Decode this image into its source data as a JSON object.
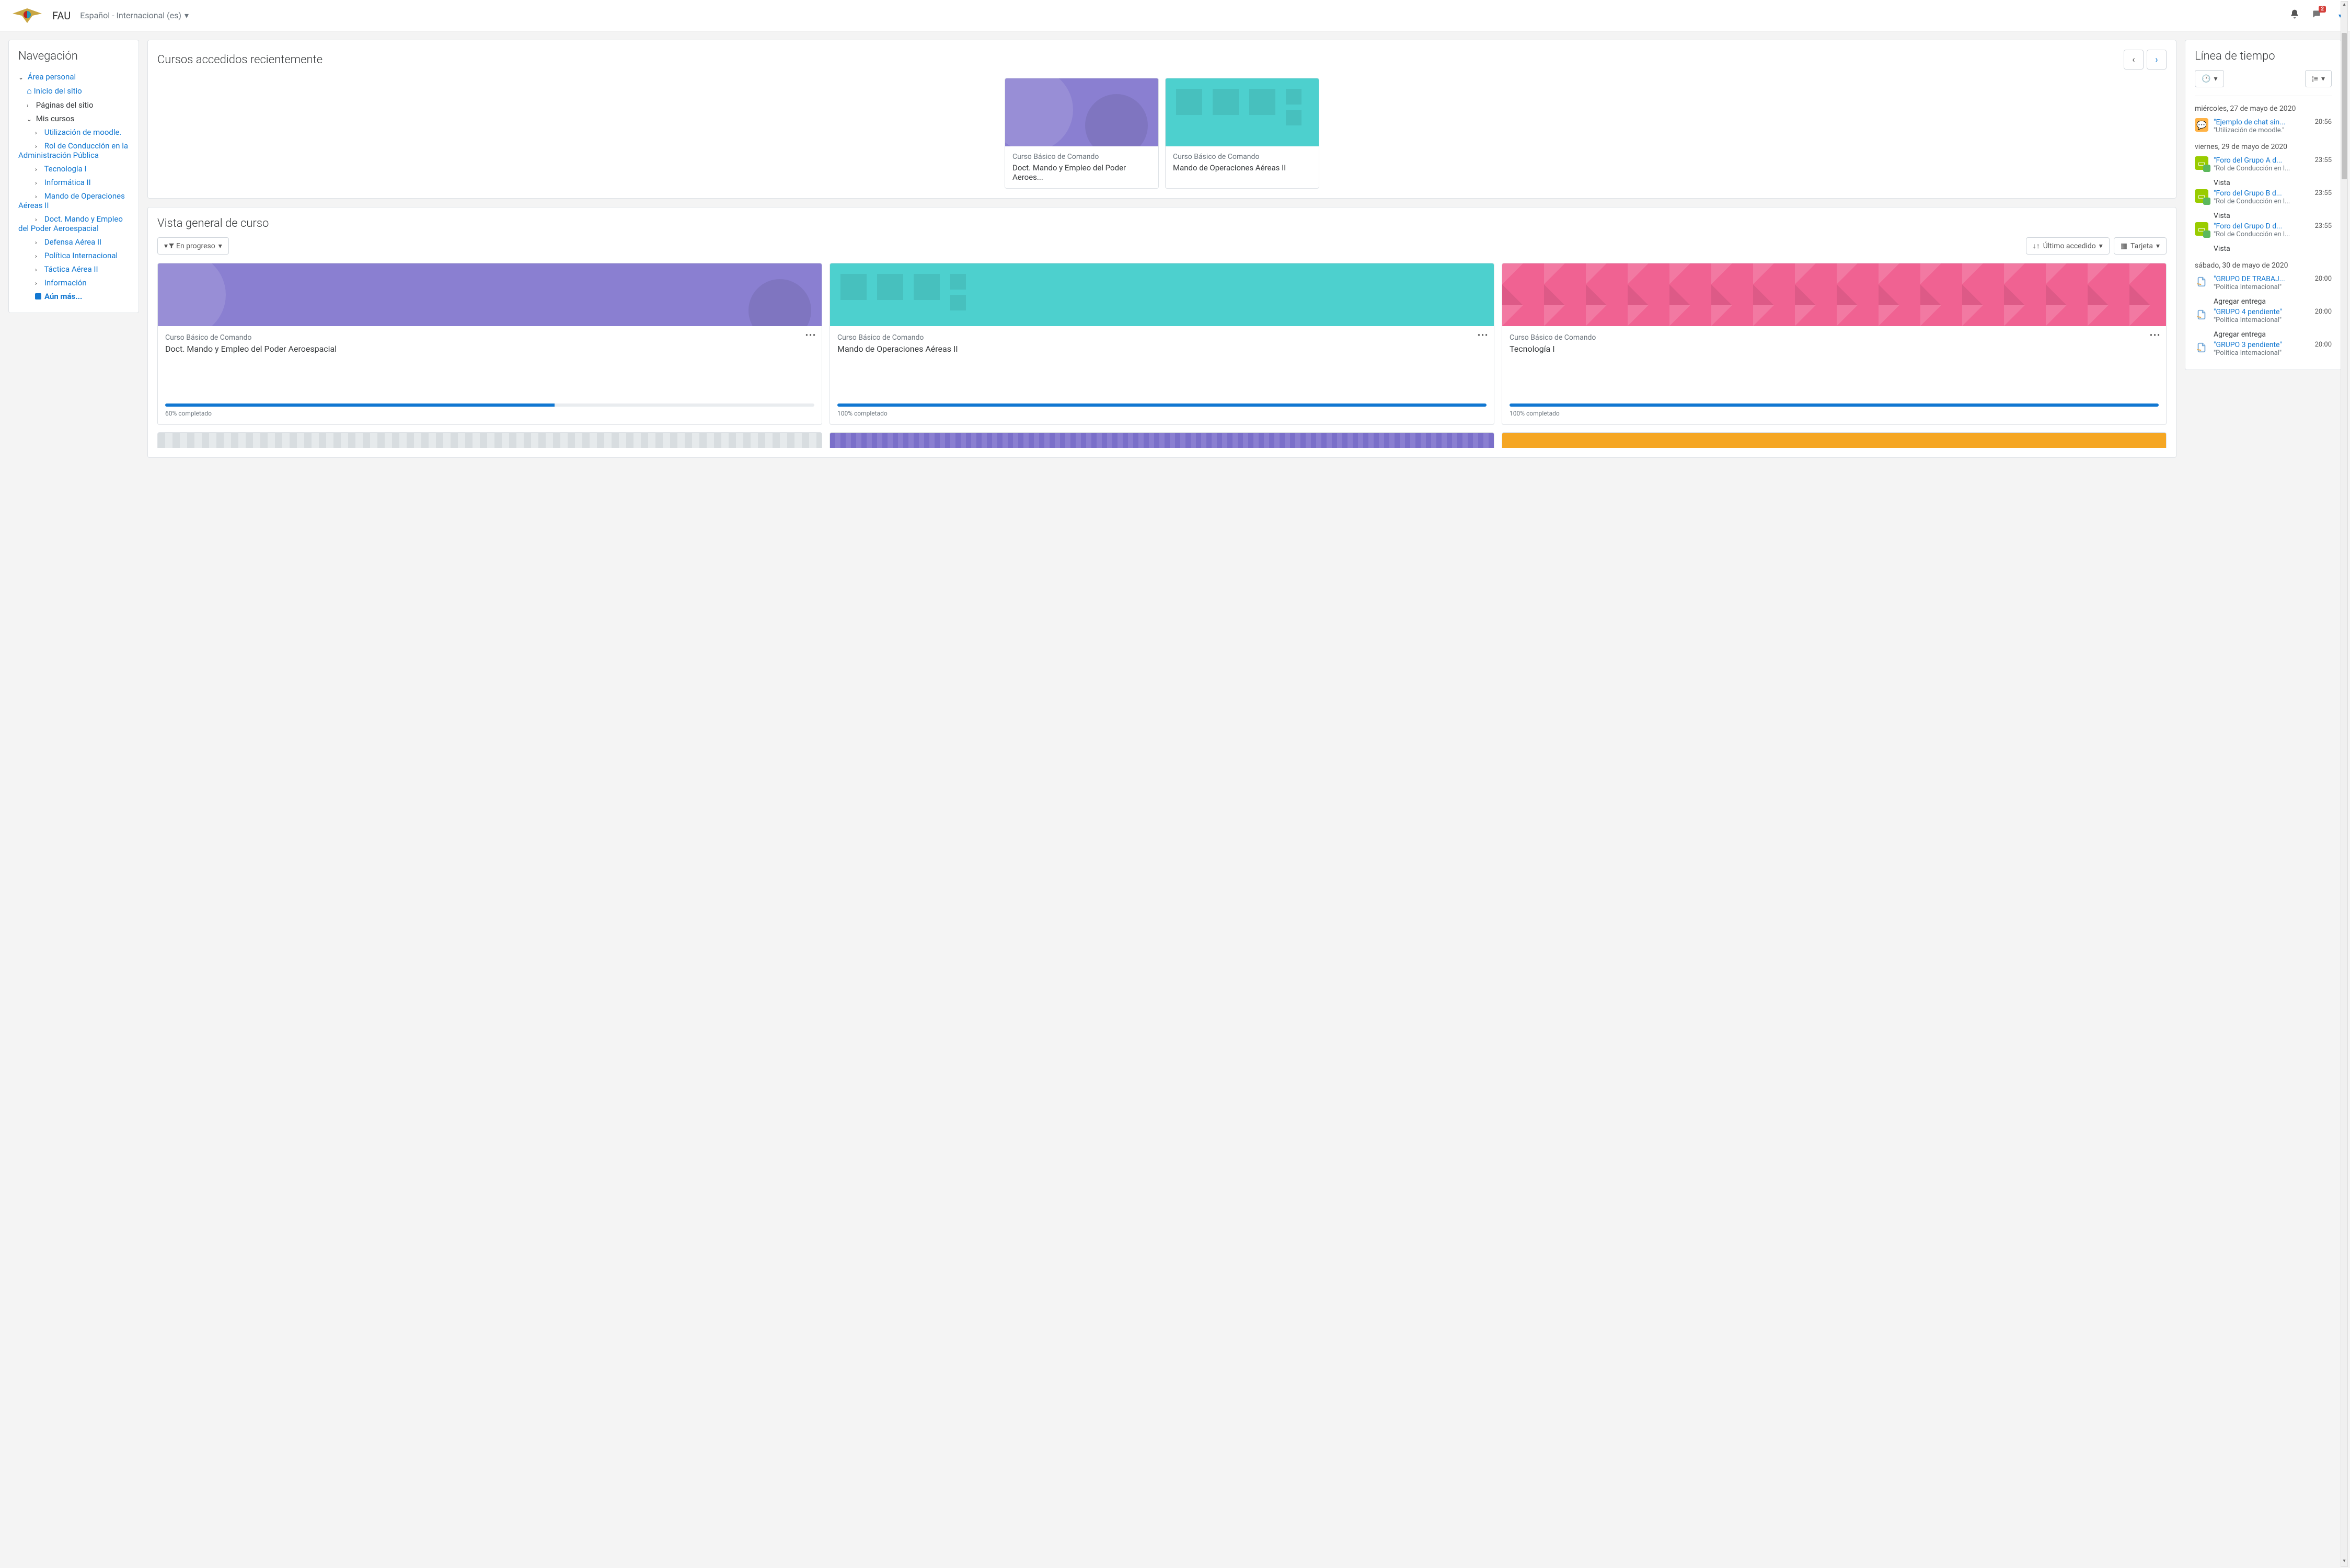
{
  "navbar": {
    "brand": "FAU",
    "language": "Español - Internacional (es)",
    "notif_count": "2"
  },
  "nav_block": {
    "title": "Navegación",
    "area_personal": "Área personal",
    "inicio": "Inicio del sitio",
    "paginas": "Páginas del sitio",
    "mis_cursos": "Mis cursos",
    "courses": [
      "Utilización de moodle.",
      "Rol de Conducción en la Administración Pública",
      "Tecnología I",
      "Informática II",
      "Mando de Operaciones Aéreas II",
      "Doct. Mando y Empleo del Poder Aeroespacial",
      "Defensa Aérea II",
      "Política Internacional",
      "Táctica Aérea II",
      "Información"
    ],
    "aun_mas": "Aún más..."
  },
  "recent": {
    "title": "Cursos accedidos recientemente",
    "cards": [
      {
        "category": "Curso Básico de Comando",
        "title": "Doct. Mando y Empleo del Poder Aeroes...",
        "style": "purple"
      },
      {
        "category": "Curso Básico de Comando",
        "title": "Mando de Operaciones Aéreas II",
        "style": "teal"
      }
    ]
  },
  "overview": {
    "title": "Vista general de curso",
    "filter": "En progreso",
    "sort": "Último accedido",
    "view": "Tarjeta",
    "cards": [
      {
        "category": "Curso Básico de Comando",
        "title": "Doct. Mando y Empleo del Poder Aeroespacial",
        "progress": 60,
        "progress_label": "60% completado",
        "style": "purple"
      },
      {
        "category": "Curso Básico de Comando",
        "title": "Mando de Operaciones Aéreas II",
        "progress": 100,
        "progress_label": "100% completado",
        "style": "teal"
      },
      {
        "category": "Curso Básico de Comando",
        "title": "Tecnología I",
        "progress": 100,
        "progress_label": "100% completado",
        "style": "pink"
      }
    ]
  },
  "timeline": {
    "title": "Línea de tiempo",
    "groups": [
      {
        "date": "miércoles, 27 de mayo de 2020",
        "items": [
          {
            "icon": "chat",
            "link": "\"Ejemplo de chat sin...",
            "sub": "\"Utilización de moodle.\"",
            "time": "20:56",
            "action": ""
          }
        ]
      },
      {
        "date": "viernes, 29 de mayo de 2020",
        "items": [
          {
            "icon": "forum",
            "link": "\"Foro del Grupo A d...",
            "sub": "\"Rol de Conducción en l...",
            "time": "23:55",
            "action": "Vista"
          },
          {
            "icon": "forum",
            "link": "\"Foro del Grupo B d...",
            "sub": "\"Rol de Conducción en l...",
            "time": "23:55",
            "action": "Vista"
          },
          {
            "icon": "forum",
            "link": "\"Foro del Grupo D d...",
            "sub": "\"Rol de Conducción en l...",
            "time": "23:55",
            "action": "Vista"
          }
        ]
      },
      {
        "date": "sábado, 30 de mayo de 2020",
        "items": [
          {
            "icon": "assign",
            "link": "\"GRUPO DE TRABAJ...",
            "sub": "\"Política Internacional\"",
            "time": "20:00",
            "action": "Agregar entrega"
          },
          {
            "icon": "assign",
            "link": "\"GRUPO 4 pendiente\"",
            "sub": "\"Política Internacional\"",
            "time": "20:00",
            "action": "Agregar entrega"
          },
          {
            "icon": "assign",
            "link": "\"GRUPO 3 pendiente\"",
            "sub": "\"Política Internacional\"",
            "time": "20:00",
            "action": ""
          }
        ]
      }
    ]
  }
}
